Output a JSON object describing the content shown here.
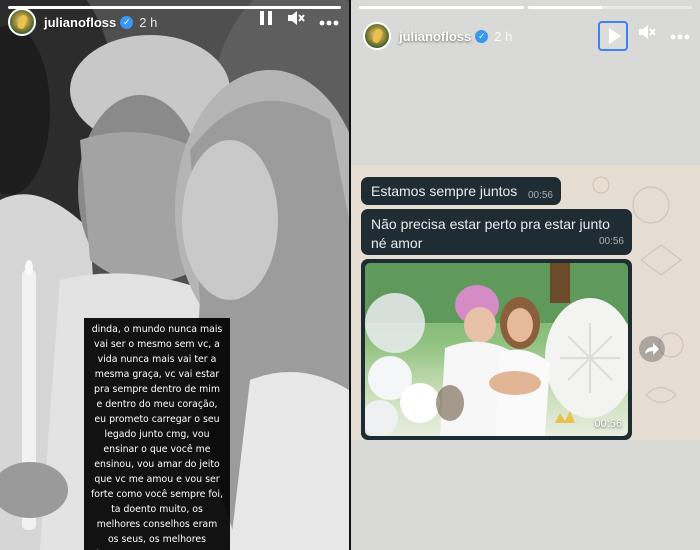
{
  "left_story": {
    "username": "julianofloss",
    "time": "2 h",
    "progress": [
      1.0
    ],
    "caption": "dinda, o mundo nunca mais vai ser o mesmo sem vc, a vida nunca mais vai ter a mesma graça, vc vai estar pra sempre dentro de mim e dentro do meu coração, eu prometo carregar o seu legado junto cmg, vou ensinar o que você me ensinou, vou amar do jeito que vc me amou e vou ser forte como você sempre foi, ta doento muito, os melhores conselhos eram os seus, os melhores abraços eram os seus. eu te amo e vou te amar pra sempre, um dia a gente se encontra por ai",
    "icons": {
      "pause": "pause-icon",
      "mute": "mute-icon",
      "more": "more-icon"
    }
  },
  "right_story": {
    "username": "julianofloss",
    "time": "2 h",
    "progress": [
      1.0,
      0.45
    ],
    "icons": {
      "play": "play-icon",
      "mute": "mute-icon",
      "more": "more-icon",
      "forward": "forward-icon"
    },
    "messages": [
      {
        "text": "Estamos sempre juntos",
        "time": "00:56"
      },
      {
        "text": "Não precisa estar perto pra estar junto né amor",
        "time": "00:56"
      },
      {
        "type": "photo",
        "time": "00:56"
      }
    ]
  },
  "colors": {
    "bubble": "#202c33",
    "accent": "#3b82f6",
    "verified": "#3897f0"
  }
}
